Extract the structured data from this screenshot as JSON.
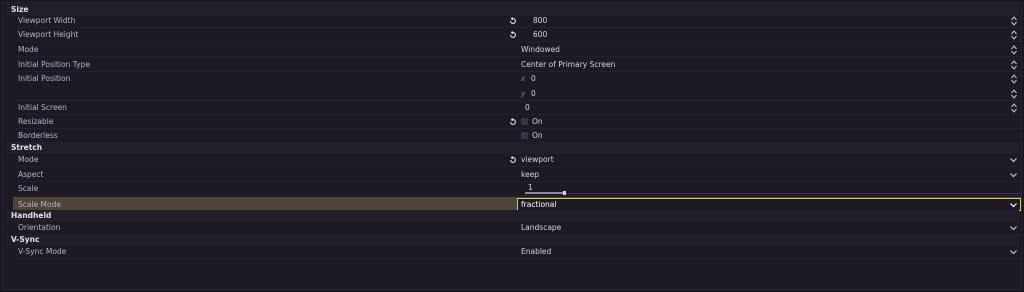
{
  "sections": {
    "size": "Size",
    "stretch": "Stretch",
    "handheld": "Handheld",
    "vsync": "V-Sync"
  },
  "size": {
    "viewport_width": {
      "label": "Viewport Width",
      "value": "800"
    },
    "viewport_height": {
      "label": "Viewport Height",
      "value": "600"
    },
    "mode": {
      "label": "Mode",
      "value": "Windowed"
    },
    "initial_position_type": {
      "label": "Initial Position Type",
      "value": "Center of Primary Screen"
    },
    "initial_position": {
      "label": "Initial Position",
      "x_label": "x",
      "x_value": "0",
      "y_label": "y",
      "y_value": "0"
    },
    "initial_screen": {
      "label": "Initial Screen",
      "value": "0"
    },
    "resizable": {
      "label": "Resizable",
      "value": "On",
      "checked": false
    },
    "borderless": {
      "label": "Borderless",
      "value": "On",
      "checked": false
    }
  },
  "stretch": {
    "mode": {
      "label": "Mode",
      "value": "viewport"
    },
    "aspect": {
      "label": "Aspect",
      "value": "keep"
    },
    "scale": {
      "label": "Scale",
      "value": "1"
    },
    "scale_mode": {
      "label": "Scale Mode",
      "value": "fractional"
    }
  },
  "handheld": {
    "orientation": {
      "label": "Orientation",
      "value": "Landscape"
    }
  },
  "vsync": {
    "mode": {
      "label": "V-Sync Mode",
      "value": "Enabled"
    }
  },
  "colors": {
    "background": "#1d1a25",
    "highlight": "#4e4437",
    "focus_border": "#e0c080"
  },
  "icons": {
    "revert": "revert-icon",
    "spinner": "spinner-arrows-icon",
    "dropdown": "chevron-down-icon",
    "checkbox": "checkbox-icon"
  }
}
